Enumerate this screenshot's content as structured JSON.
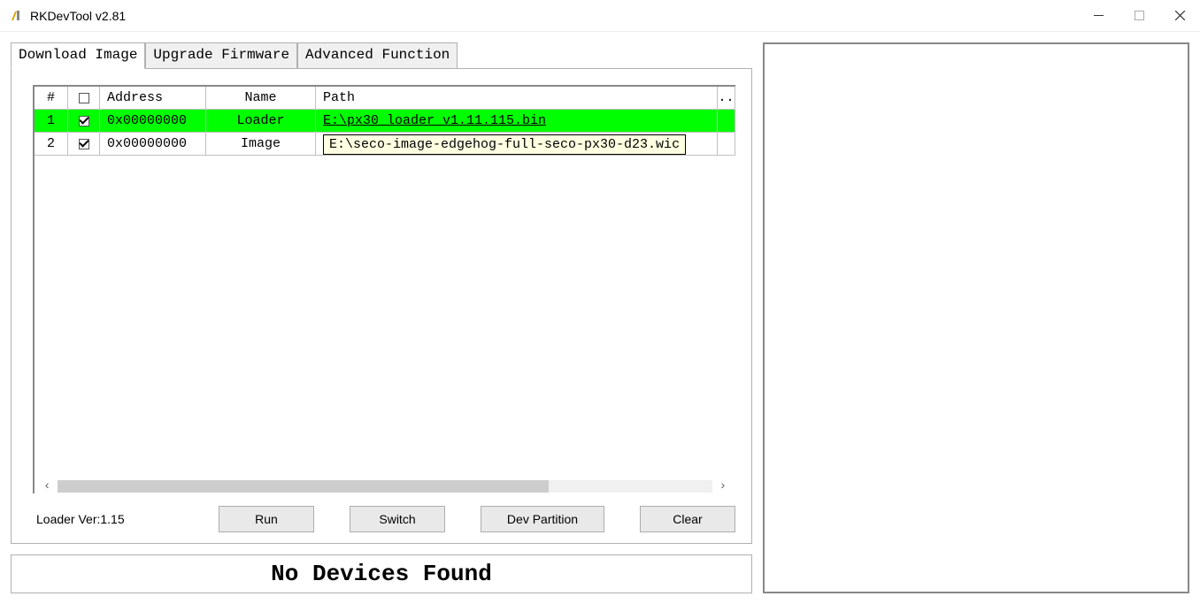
{
  "window": {
    "title": "RKDevTool v2.81"
  },
  "tabs": [
    {
      "label": "Download Image",
      "active": true
    },
    {
      "label": "Upgrade Firmware",
      "active": false
    },
    {
      "label": "Advanced Function",
      "active": false
    }
  ],
  "table": {
    "headers": {
      "num": "#",
      "check": "",
      "address": "Address",
      "name": "Name",
      "path": "Path",
      "dots": ".."
    },
    "rows": [
      {
        "num": "1",
        "checked": true,
        "address": "0x00000000",
        "name": "Loader",
        "path": "E:\\px30_loader_v1.11.115.bin",
        "selected": true
      },
      {
        "num": "2",
        "checked": true,
        "address": "0x00000000",
        "name": "Image",
        "path": "",
        "selected": false
      }
    ],
    "tooltip": "E:\\seco-image-edgehog-full-seco-px30-d23.wic"
  },
  "footer": {
    "loader_ver": "Loader Ver:1.15",
    "buttons": {
      "run": "Run",
      "switch": "Switch",
      "dev_partition": "Dev Partition",
      "clear": "Clear"
    }
  },
  "status": "No Devices Found"
}
